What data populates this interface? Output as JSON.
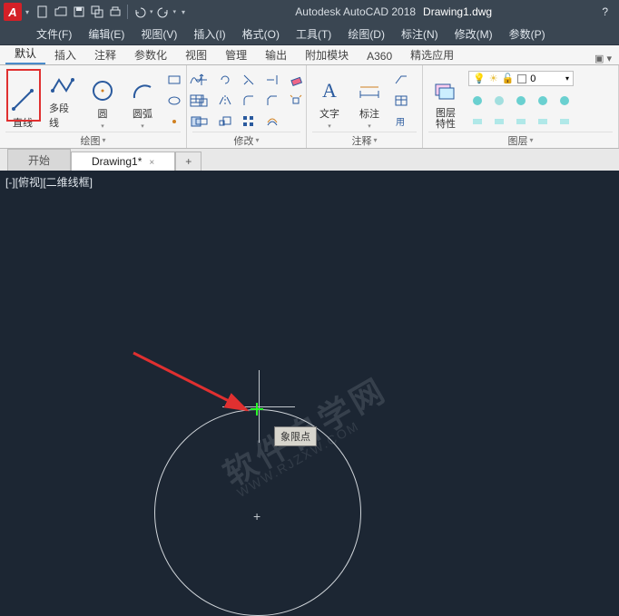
{
  "title": {
    "app": "Autodesk AutoCAD 2018",
    "doc": "Drawing1.dwg"
  },
  "menu": [
    "文件(F)",
    "编辑(E)",
    "视图(V)",
    "插入(I)",
    "格式(O)",
    "工具(T)",
    "绘图(D)",
    "标注(N)",
    "修改(M)",
    "参数(P)"
  ],
  "ribbon_tabs": [
    "默认",
    "插入",
    "注释",
    "参数化",
    "视图",
    "管理",
    "输出",
    "附加模块",
    "A360",
    "精选应用"
  ],
  "panels": {
    "draw": {
      "label": "绘图",
      "line": "直线",
      "polyline": "多段线",
      "circle": "圆",
      "arc": "圆弧"
    },
    "modify": {
      "label": "修改"
    },
    "annotate": {
      "label": "注释",
      "text": "文字",
      "dim": "标注",
      "table_icon": "table"
    },
    "layer": {
      "label": "图层",
      "props": "图层\n特性",
      "current": "0"
    }
  },
  "doc_tabs": {
    "start": "开始",
    "active": "Drawing1*"
  },
  "canvas": {
    "view_label": "[-][俯视][二维线框]",
    "tooltip": "象限点",
    "watermark_main": "软件自学网",
    "watermark_sub": "WWW.RJZXW.COM"
  }
}
